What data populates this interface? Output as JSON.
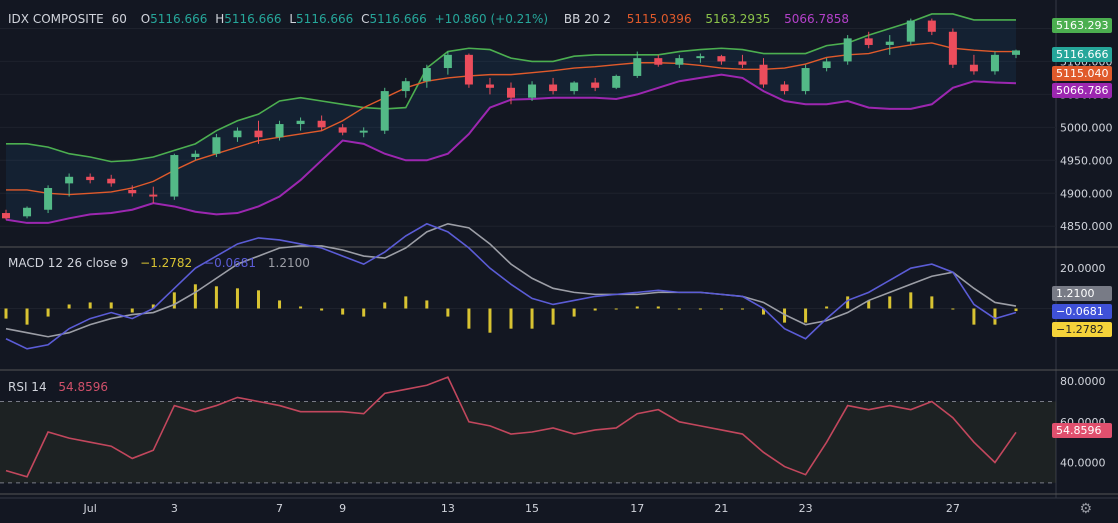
{
  "symbol": {
    "name": "IDX COMPOSITE",
    "interval": "60",
    "o_label": "O",
    "o": "5116.666",
    "h_label": "H",
    "h": "5116.666",
    "l_label": "L",
    "l": "5116.666",
    "c_label": "C",
    "c": "5116.666",
    "change": "+10.860 (+0.21%)"
  },
  "bb": {
    "label": "BB 20 2",
    "basis": "5115.0396",
    "upper": "5163.2935",
    "lower": "5066.7858"
  },
  "macd": {
    "label": "MACD 12 26 close 9",
    "hist": "−1.2782",
    "macd": "−0.0681",
    "signal": "1.2100"
  },
  "rsi": {
    "label": "RSI 14",
    "value": "54.8596"
  },
  "colors": {
    "up": "#26a69a",
    "candle_up": "#53b987",
    "candle_down": "#eb4d5c",
    "bb_basis": "#e05a2b",
    "bb_band": "#4caf50",
    "bb_lower": "#9c27b0",
    "macd_line": "#5b5cd6",
    "signal_line": "#9c9ea6",
    "hist": "#d8c332",
    "rsi": "#c2475d"
  },
  "chart_data": [
    {
      "type": "candlestick",
      "title": "IDX COMPOSITE",
      "interval": "60",
      "x_ticks": [
        "Jul",
        "3",
        "7",
        "9",
        "13",
        "15",
        "17",
        "21",
        "23",
        "27"
      ],
      "y_ticks": [
        4850,
        4900,
        4950,
        5000,
        5050,
        5100,
        5150
      ],
      "ylim": [
        4820,
        5175
      ],
      "price_labels": {
        "upper": "5163.293",
        "close": "5116.666",
        "basis": "5115.040",
        "lower": "5066.786"
      },
      "bb_upper": [
        4975,
        4975,
        4970,
        4960,
        4955,
        4948,
        4950,
        4955,
        4965,
        4975,
        4995,
        5010,
        5020,
        5040,
        5045,
        5040,
        5035,
        5030,
        5028,
        5030,
        5090,
        5115,
        5120,
        5118,
        5105,
        5100,
        5100,
        5108,
        5110,
        5110,
        5110,
        5110,
        5115,
        5118,
        5120,
        5118,
        5112,
        5112,
        5112,
        5124,
        5128,
        5140,
        5150,
        5160,
        5172,
        5172,
        5163,
        5163,
        5163
      ],
      "bb_basis": [
        4905,
        4905,
        4900,
        4898,
        4900,
        4902,
        4908,
        4918,
        4935,
        4950,
        4960,
        4970,
        4980,
        4985,
        4990,
        4995,
        5010,
        5030,
        5045,
        5060,
        5070,
        5075,
        5078,
        5080,
        5080,
        5083,
        5086,
        5090,
        5092,
        5095,
        5098,
        5098,
        5097,
        5094,
        5090,
        5088,
        5088,
        5090,
        5096,
        5106,
        5110,
        5112,
        5120,
        5125,
        5128,
        5120,
        5117,
        5115,
        5115
      ],
      "bb_lower": [
        4860,
        4855,
        4855,
        4862,
        4868,
        4870,
        4875,
        4885,
        4880,
        4872,
        4868,
        4870,
        4880,
        4895,
        4920,
        4950,
        4980,
        4975,
        4960,
        4950,
        4950,
        4960,
        4990,
        5030,
        5042,
        5043,
        5045,
        5045,
        5045,
        5043,
        5050,
        5060,
        5070,
        5075,
        5080,
        5075,
        5055,
        5040,
        5035,
        5035,
        5040,
        5030,
        5028,
        5028,
        5035,
        5060,
        5070,
        5068,
        5067
      ],
      "candles": [
        [
          4870,
          4875,
          4860,
          4862
        ],
        [
          4865,
          4880,
          4862,
          4878
        ],
        [
          4875,
          4912,
          4870,
          4908
        ],
        [
          4915,
          4930,
          4895,
          4925
        ],
        [
          4925,
          4930,
          4915,
          4920
        ],
        [
          4922,
          4928,
          4910,
          4915
        ],
        [
          4905,
          4912,
          4895,
          4900
        ],
        [
          4898,
          4910,
          4885,
          4895
        ],
        [
          4895,
          4960,
          4890,
          4958
        ],
        [
          4955,
          4965,
          4950,
          4960
        ],
        [
          4960,
          4990,
          4955,
          4985
        ],
        [
          4985,
          5000,
          4978,
          4995
        ],
        [
          4995,
          5010,
          4975,
          4985
        ],
        [
          4985,
          5010,
          4980,
          5005
        ],
        [
          5005,
          5015,
          4995,
          5010
        ],
        [
          5010,
          5018,
          4995,
          5000
        ],
        [
          5000,
          5005,
          4988,
          4992
        ],
        [
          4992,
          5000,
          4985,
          4995
        ],
        [
          4995,
          5060,
          4990,
          5055
        ],
        [
          5055,
          5075,
          5045,
          5070
        ],
        [
          5070,
          5095,
          5060,
          5090
        ],
        [
          5090,
          5115,
          5080,
          5110
        ],
        [
          5110,
          5112,
          5060,
          5065
        ],
        [
          5065,
          5075,
          5050,
          5060
        ],
        [
          5060,
          5068,
          5035,
          5045
        ],
        [
          5045,
          5070,
          5040,
          5065
        ],
        [
          5065,
          5075,
          5050,
          5055
        ],
        [
          5055,
          5070,
          5050,
          5068
        ],
        [
          5068,
          5075,
          5055,
          5060
        ],
        [
          5060,
          5080,
          5058,
          5078
        ],
        [
          5078,
          5115,
          5075,
          5105
        ],
        [
          5105,
          5110,
          5092,
          5095
        ],
        [
          5095,
          5110,
          5090,
          5105
        ],
        [
          5105,
          5112,
          5098,
          5108
        ],
        [
          5108,
          5110,
          5095,
          5100
        ],
        [
          5100,
          5110,
          5090,
          5095
        ],
        [
          5095,
          5105,
          5060,
          5065
        ],
        [
          5065,
          5070,
          5050,
          5055
        ],
        [
          5055,
          5095,
          5050,
          5090
        ],
        [
          5090,
          5105,
          5085,
          5100
        ],
        [
          5100,
          5140,
          5095,
          5135
        ],
        [
          5135,
          5145,
          5120,
          5125
        ],
        [
          5125,
          5140,
          5110,
          5130
        ],
        [
          5130,
          5165,
          5125,
          5162
        ],
        [
          5162,
          5165,
          5140,
          5145
        ],
        [
          5145,
          5150,
          5090,
          5095
        ],
        [
          5095,
          5110,
          5080,
          5085
        ],
        [
          5085,
          5115,
          5080,
          5110
        ],
        [
          5110,
          5118,
          5105,
          5116.666
        ]
      ]
    },
    {
      "type": "line",
      "title": "MACD 12 26 close 9",
      "y_ticks": [
        20.0
      ],
      "value_labels": {
        "signal": "1.2100",
        "macd": "−0.0681",
        "hist": "−1.2782"
      },
      "macd": [
        -15,
        -20,
        -18,
        -10,
        -5,
        -2,
        -5,
        0,
        10,
        20,
        26,
        32,
        35,
        34,
        32,
        30,
        26,
        22,
        28,
        36,
        42,
        38,
        30,
        20,
        12,
        5,
        2,
        4,
        6,
        7,
        8,
        9,
        8,
        8,
        7,
        6,
        0,
        -10,
        -15,
        -5,
        4,
        8,
        14,
        20,
        22,
        18,
        2,
        -5,
        -2
      ],
      "signal": [
        -10,
        -12,
        -14,
        -12,
        -8,
        -5,
        -3,
        -2,
        2,
        8,
        15,
        22,
        26,
        30,
        31,
        31,
        29,
        26,
        25,
        30,
        38,
        42,
        40,
        32,
        22,
        15,
        10,
        8,
        7,
        7,
        7,
        8,
        8,
        8,
        7,
        6,
        3,
        -3,
        -8,
        -6,
        -2,
        4,
        8,
        12,
        16,
        18,
        10,
        3,
        1.21
      ],
      "histogram": [
        -5,
        -8,
        -4,
        2,
        3,
        3,
        -2,
        2,
        8,
        12,
        11,
        10,
        9,
        4,
        1,
        -1,
        -3,
        -4,
        3,
        6,
        4,
        -4,
        -10,
        -12,
        -10,
        -10,
        -8,
        -4,
        -1,
        0,
        1,
        1,
        0,
        0,
        0,
        0,
        -3,
        -7,
        -7,
        1,
        6,
        4,
        6,
        8,
        6,
        0,
        -8,
        -8,
        -1.28
      ]
    },
    {
      "type": "line",
      "title": "RSI 14",
      "y_ticks": [
        40,
        60,
        80
      ],
      "bands": [
        70,
        30
      ],
      "values": [
        36,
        33,
        55,
        52,
        50,
        48,
        42,
        46,
        68,
        65,
        68,
        72,
        70,
        68,
        65,
        65,
        65,
        64,
        74,
        76,
        78,
        82,
        60,
        58,
        54,
        55,
        57,
        54,
        56,
        57,
        64,
        66,
        60,
        58,
        56,
        54,
        45,
        38,
        34,
        50,
        68,
        66,
        68,
        66,
        70,
        62,
        50,
        40,
        54.86
      ]
    }
  ]
}
